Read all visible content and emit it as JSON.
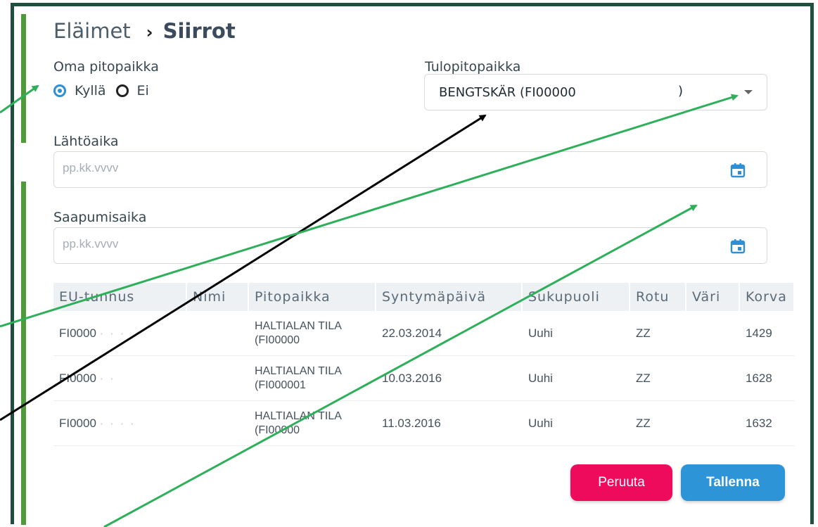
{
  "breadcrumb": {
    "parent": "Eläimet",
    "separator": "›",
    "current": "Siirrot"
  },
  "own_location": {
    "label": "Oma pitopaikka",
    "options": [
      "Kyllä",
      "Ei"
    ],
    "selected": "Kyllä"
  },
  "destination": {
    "label": "Tulopitopaikka",
    "value": "BENGTSKÄR (FI00000",
    "value_suffix": ")"
  },
  "departure": {
    "label": "Lähtöaika",
    "placeholder": "pp.kk.vvvv"
  },
  "arrival": {
    "label": "Saapumisaika",
    "placeholder": "pp.kk.vvvv"
  },
  "table": {
    "headers": [
      "EU-tunnus",
      "Nimi",
      "Pitopaikka",
      "Syntymäpäivä",
      "Sukupuoli",
      "Rotu",
      "Väri",
      "Korva"
    ],
    "rows": [
      {
        "eu": "FI0000",
        "eu_hidden": "· · ·",
        "name": "",
        "pito1": "HALTIALAN TILA",
        "pito2": "(FI00000",
        "birth": "22.03.2014",
        "sex": "Uuhi",
        "breed": "ZZ",
        "color": "",
        "ear": "1429"
      },
      {
        "eu": "FI0000",
        "eu_hidden": "· ·",
        "name": "",
        "pito1": "HALTIALAN TILA",
        "pito2": "(FI000001",
        "birth": "10.03.2016",
        "sex": "Uuhi",
        "breed": "ZZ",
        "color": "",
        "ear": "1628"
      },
      {
        "eu": "FI0000",
        "eu_hidden": "· · · ·",
        "name": "",
        "pito1": "HALTIALAN TILA",
        "pito2": "(FI00000",
        "birth": "11.03.2016",
        "sex": "Uuhi",
        "breed": "ZZ",
        "color": "",
        "ear": "1632"
      }
    ]
  },
  "buttons": {
    "cancel": "Peruuta",
    "save": "Tallenna"
  },
  "colors": {
    "frame": "#1f4f3f",
    "accent": "#4f9a3b",
    "cancel": "#ee0b5c",
    "save": "#2d94d8",
    "radio": "#2d8fd5",
    "arrow_green": "#2eaf5a",
    "arrow_black": "#000000"
  }
}
